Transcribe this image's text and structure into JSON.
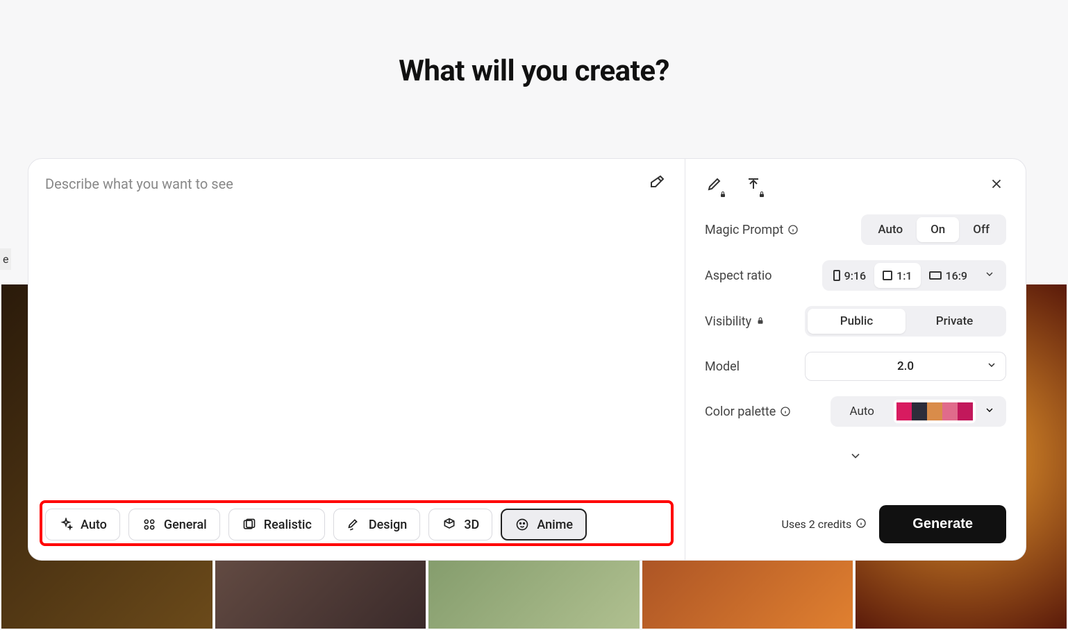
{
  "header": {
    "title": "What will you create?"
  },
  "prompt": {
    "placeholder": "Describe what you want to see"
  },
  "styles": {
    "items": [
      {
        "label": "Auto",
        "icon": "sparkle"
      },
      {
        "label": "General",
        "icon": "grid"
      },
      {
        "label": "Realistic",
        "icon": "photo"
      },
      {
        "label": "Design",
        "icon": "pen"
      },
      {
        "label": "3D",
        "icon": "cube"
      },
      {
        "label": "Anime",
        "icon": "face"
      }
    ],
    "selected": "Anime"
  },
  "settings": {
    "magic_prompt": {
      "label": "Magic Prompt",
      "options": [
        "Auto",
        "On",
        "Off"
      ],
      "selected": "On"
    },
    "aspect_ratio": {
      "label": "Aspect ratio",
      "options": [
        "9:16",
        "1:1",
        "16:9"
      ],
      "selected": "1:1"
    },
    "visibility": {
      "label": "Visibility",
      "options": [
        "Public",
        "Private"
      ],
      "selected": "Public"
    },
    "model": {
      "label": "Model",
      "value": "2.0"
    },
    "color_palette": {
      "label": "Color palette",
      "auto_label": "Auto",
      "swatches": [
        "#d81b60",
        "#2d2d3a",
        "#d98c4a",
        "#e06b8b",
        "#c2185b"
      ]
    }
  },
  "footer": {
    "credits_text": "Uses 2 credits",
    "generate_label": "Generate"
  },
  "side_label": "e"
}
